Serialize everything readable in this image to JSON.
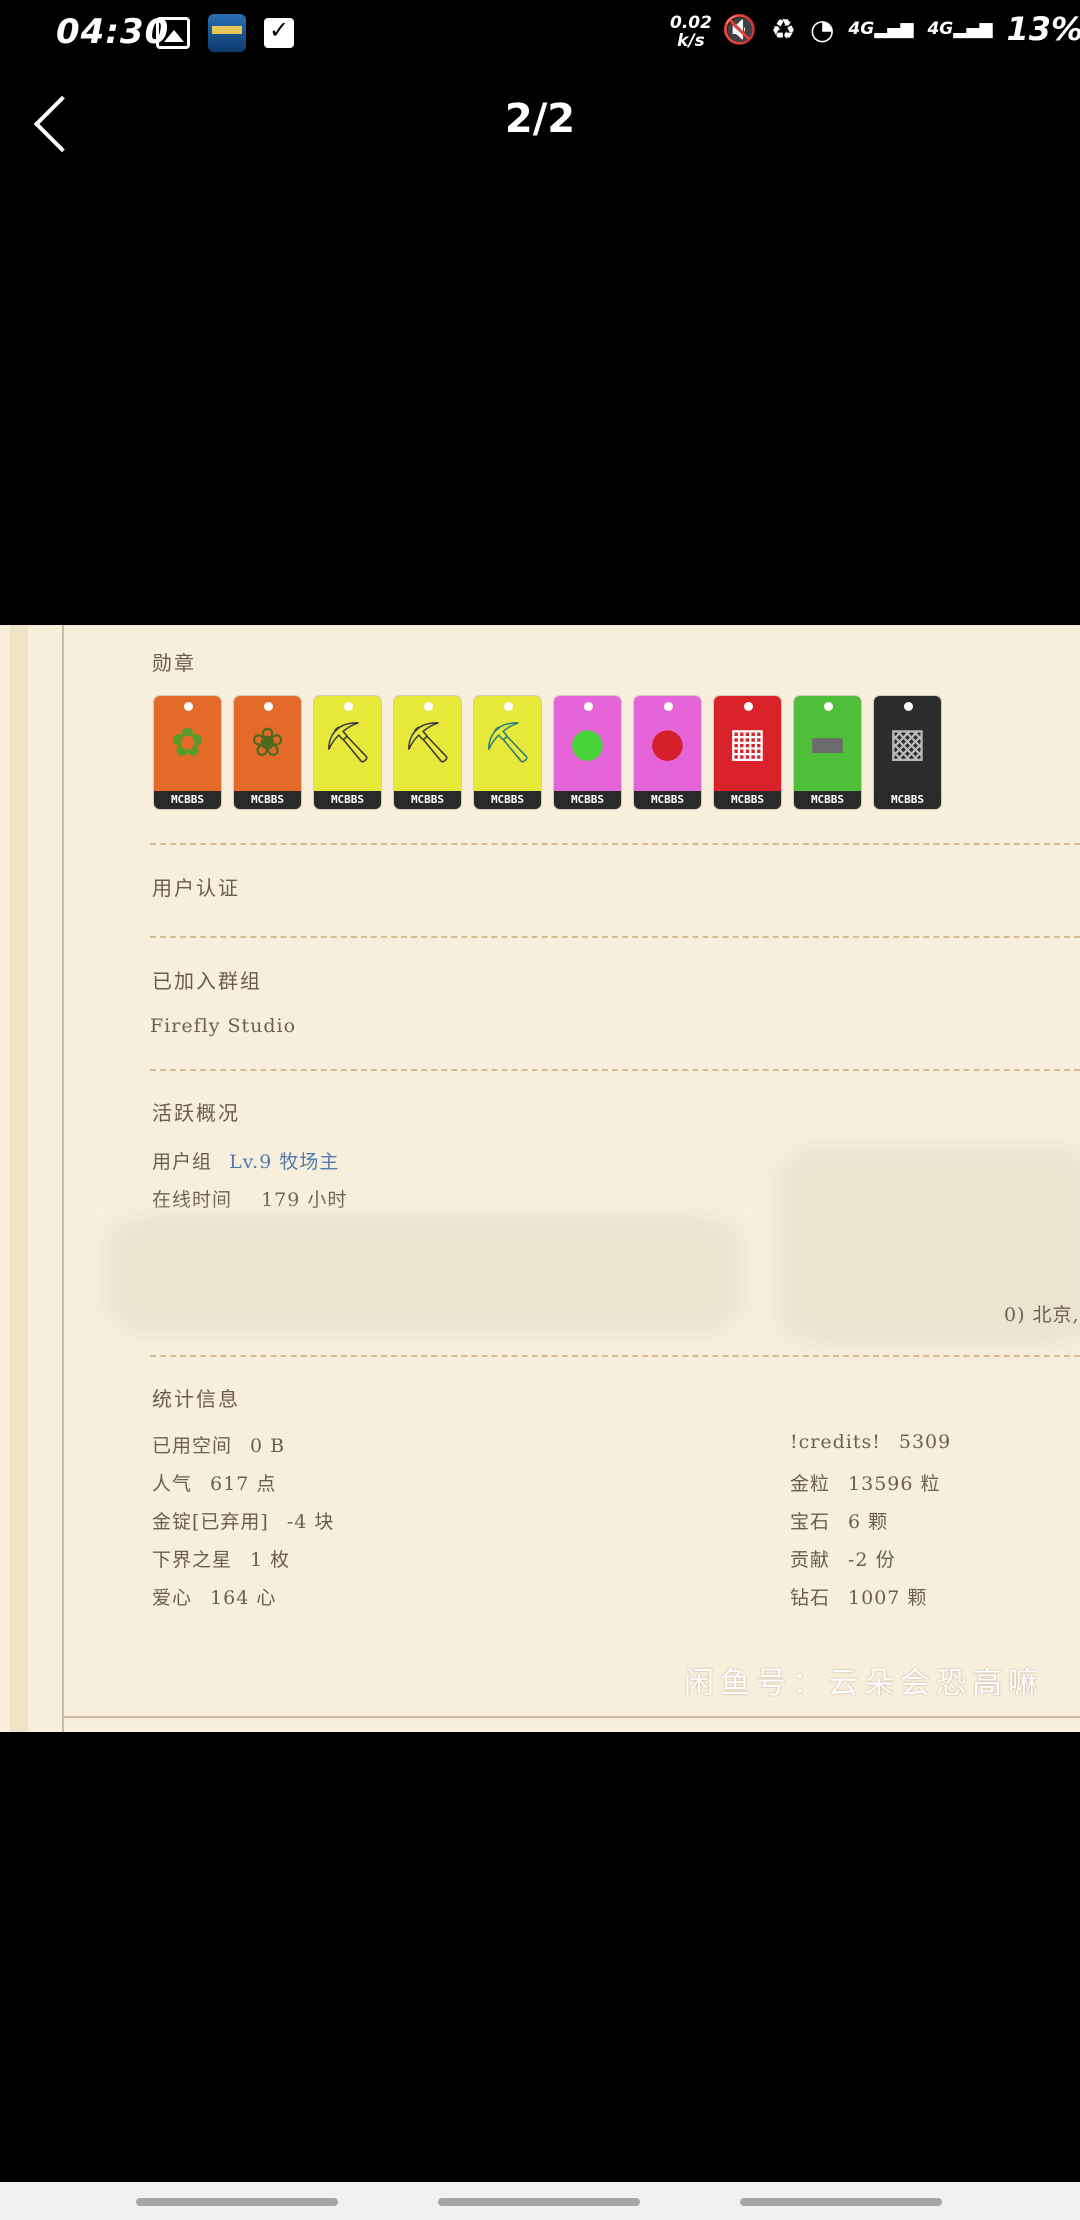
{
  "status_bar": {
    "time": "04:30",
    "net_speed_value": "0.02",
    "net_speed_unit": "k/s",
    "network": "4G",
    "network2": "4G",
    "battery": "13%",
    "icons": [
      "image-icon",
      "app-icon",
      "check-icon",
      "mute-icon",
      "recycle-icon",
      "wifi-icon",
      "signal-icon",
      "battery-icon"
    ]
  },
  "viewer": {
    "counter": "2/2"
  },
  "profile": {
    "badges_title": "勋章",
    "badges": [
      {
        "label": "MCBBS",
        "color": "#e46a2a",
        "icon": "sprout-icon",
        "glyph": "✿"
      },
      {
        "label": "MCBBS",
        "color": "#e46a2a",
        "icon": "bush-icon",
        "glyph": "❀"
      },
      {
        "label": "MCBBS",
        "color": "#e8e83b",
        "icon": "pickaxe-icon",
        "glyph": "⛏"
      },
      {
        "label": "MCBBS",
        "color": "#e8e83b",
        "icon": "pickaxe-icon",
        "glyph": "⛏"
      },
      {
        "label": "MCBBS",
        "color": "#e8e83b",
        "icon": "diamond-pickaxe-icon",
        "glyph": "⛏"
      },
      {
        "label": "MCBBS",
        "color": "#e565d8",
        "icon": "green-apple-icon",
        "glyph": "●"
      },
      {
        "label": "MCBBS",
        "color": "#e565d8",
        "icon": "red-apple-icon",
        "glyph": "●"
      },
      {
        "label": "MCBBS",
        "color": "#d9222a",
        "icon": "window-icon",
        "glyph": "▦"
      },
      {
        "label": "MCBBS",
        "color": "#4fbf3a",
        "icon": "minecart-icon",
        "glyph": "▬"
      },
      {
        "label": "MCBBS",
        "color": "#2c2c2c",
        "icon": "ore-icon",
        "glyph": "▩"
      }
    ],
    "verification_title": "用户认证",
    "groups_title": "已加入群组",
    "group_name": "Firefly Studio",
    "activity_title": "活跃概况",
    "user_group_label": "用户组",
    "user_group_value": "Lv.9 牧场主",
    "online_label": "在线时间",
    "online_value": "179 小时",
    "location_suffix": "0) 北京,",
    "stats_title": "统计信息",
    "stats_left": [
      {
        "label": "已用空间",
        "value": "0 B"
      },
      {
        "label": "人气",
        "value": "617 点"
      },
      {
        "label": "金锭[已弃用]",
        "value": "-4 块"
      },
      {
        "label": "下界之星",
        "value": "1 枚"
      },
      {
        "label": "爱心",
        "value": "164 心"
      }
    ],
    "stats_right": [
      {
        "label": "!credits!",
        "value": "5309"
      },
      {
        "label": "金粒",
        "value": "13596 粒"
      },
      {
        "label": "宝石",
        "value": "6 颗"
      },
      {
        "label": "贡献",
        "value": "-2 份"
      },
      {
        "label": "钻石",
        "value": "1007 颗"
      }
    ],
    "watermark": "闲鱼号：云朵会恐高嘛"
  }
}
